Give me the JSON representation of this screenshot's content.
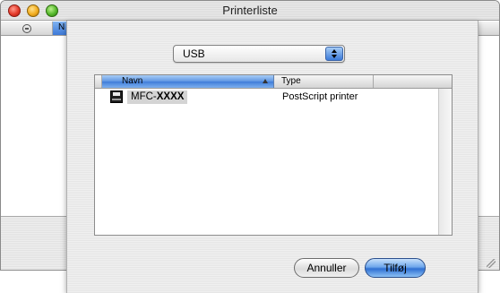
{
  "window": {
    "title": "Printerliste",
    "column_fragment": "N"
  },
  "sheet": {
    "connection_popup": {
      "value": "USB"
    },
    "table": {
      "columns": [
        "Navn",
        "Type"
      ],
      "rows": [
        {
          "name_prefix": "MFC-",
          "name_suffix": "XXXX",
          "type": "PostScript printer"
        }
      ]
    },
    "buttons": {
      "cancel": "Annuller",
      "add": "Tilføj"
    }
  },
  "colors": {
    "selection_blue": "#3f7cd9",
    "row_highlight": "#d4d4d4"
  }
}
